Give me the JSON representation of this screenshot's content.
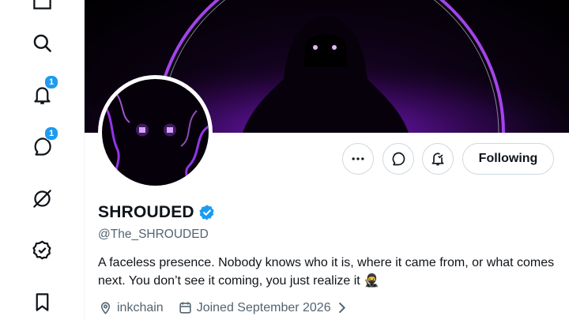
{
  "nav": {
    "notifications_badge": "1",
    "messages_badge": "1"
  },
  "profile": {
    "display_name": "SHROUDED",
    "handle": "@The_SHROUDED",
    "bio": "A faceless presence. Nobody knows who it is, where it came from, or what comes next. You don’t see it coming, you just realize it 🥷",
    "location": "inkchain",
    "joined": "Joined September 2026"
  },
  "actions": {
    "follow_label": "Following"
  },
  "colors": {
    "accent": "#1d9bf0",
    "text_primary": "#0f1419",
    "text_secondary": "#536471",
    "border": "#cfd9de",
    "banner_glow": "#9b30ff"
  },
  "icons": [
    "home-icon",
    "search-icon",
    "bell-icon",
    "messages-icon",
    "grok-icon",
    "verified-icon",
    "bookmark-icon",
    "more-icon",
    "message-icon",
    "notify-icon",
    "location-icon",
    "calendar-icon",
    "chevron-right-icon"
  ]
}
